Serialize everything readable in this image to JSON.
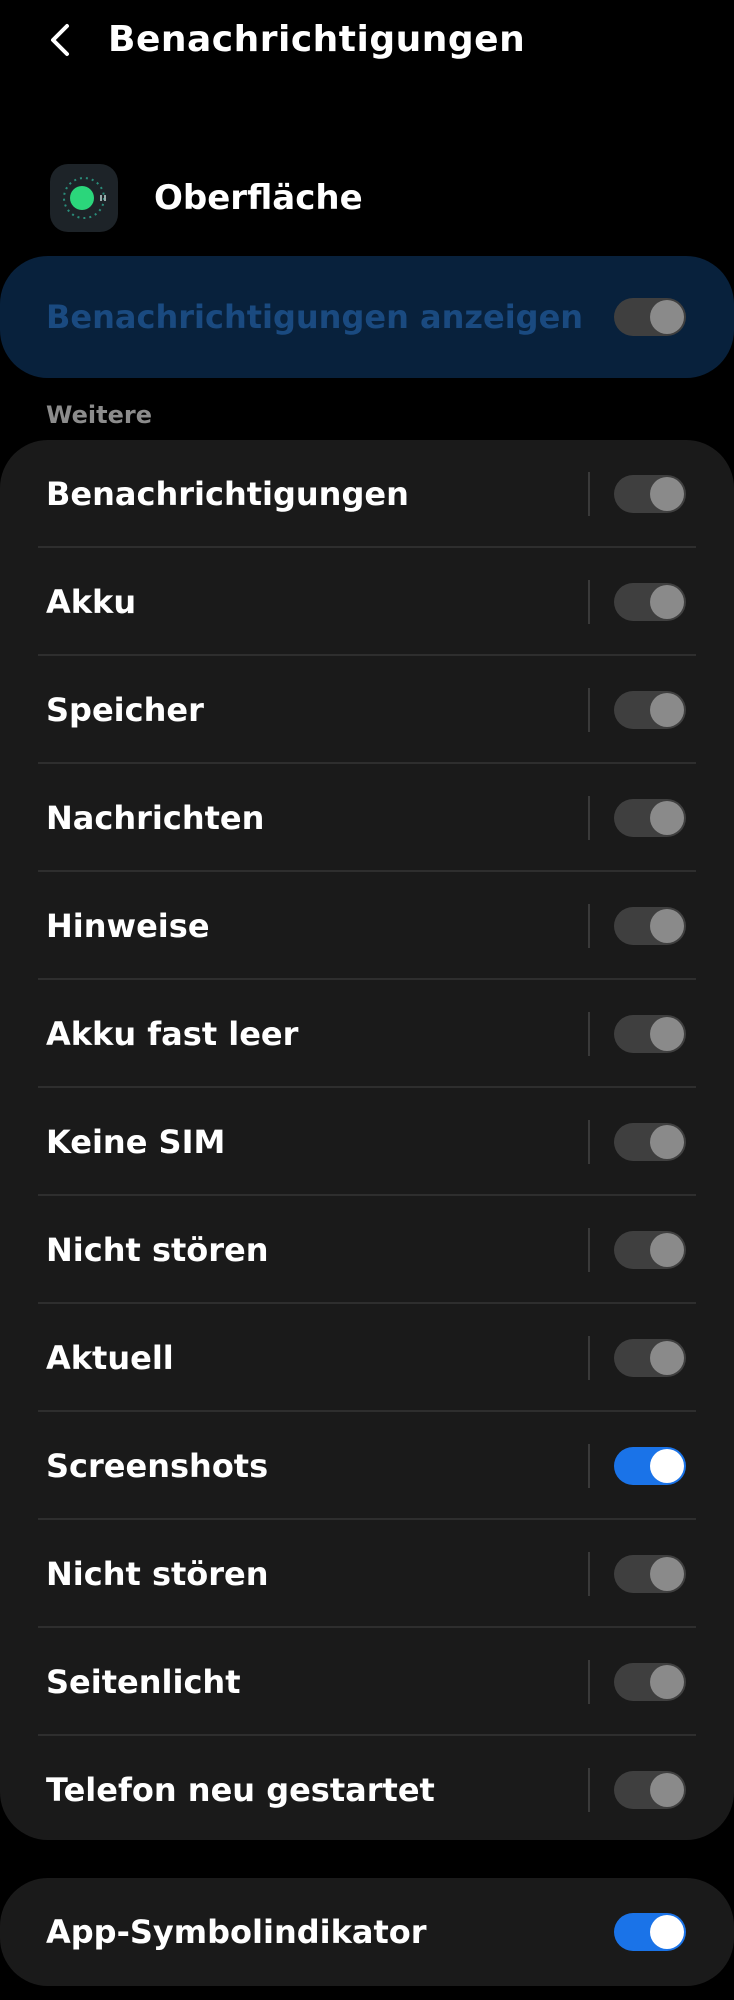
{
  "header": {
    "title": "Benachrichtigungen"
  },
  "app": {
    "name": "Oberfläche"
  },
  "master": {
    "label": "Benachrichtigungen anzeigen",
    "enabled": false
  },
  "section": {
    "label": "Weitere"
  },
  "items": [
    {
      "label": "Benachrichtigungen",
      "enabled": false
    },
    {
      "label": "Akku",
      "enabled": false
    },
    {
      "label": "Speicher",
      "enabled": false
    },
    {
      "label": "Nachrichten",
      "enabled": false
    },
    {
      "label": "Hinweise",
      "enabled": false
    },
    {
      "label": "Akku fast leer",
      "enabled": false
    },
    {
      "label": "Keine SIM",
      "enabled": false
    },
    {
      "label": "Nicht stören",
      "enabled": false
    },
    {
      "label": "Aktuell",
      "enabled": false
    },
    {
      "label": "Screenshots",
      "enabled": true
    },
    {
      "label": "Nicht stören",
      "enabled": false
    },
    {
      "label": "Seitenlicht",
      "enabled": false
    },
    {
      "label": "Telefon neu gestartet",
      "enabled": false
    }
  ],
  "bottom": {
    "label": "App-Symbolindikator",
    "enabled": true
  },
  "colors": {
    "accent": "#1a73e8",
    "master_bg": "#08213c",
    "card_bg": "#1a1a1a"
  }
}
